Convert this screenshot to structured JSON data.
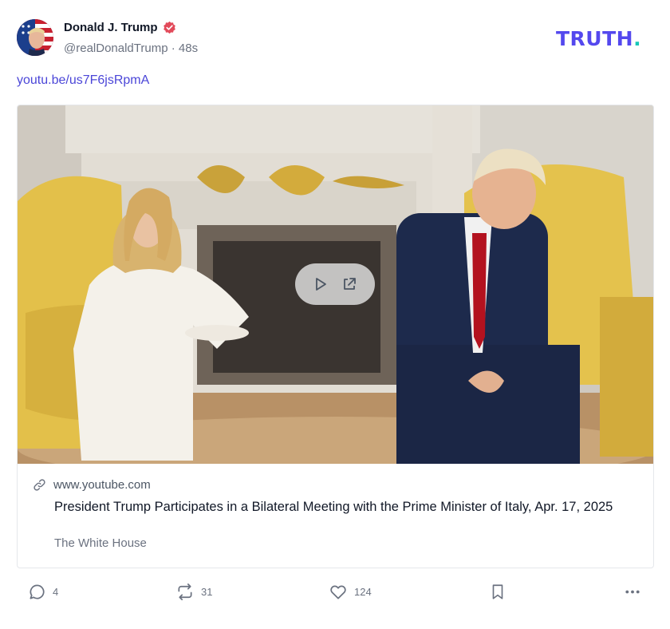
{
  "author": {
    "display_name": "Donald J. Trump",
    "handle": "@realDonaldTrump",
    "separator": "·",
    "time_ago": "48s",
    "verified_icon": "verified-badge-icon",
    "verified_color": "#e24a5a"
  },
  "brand": {
    "logo_text": "TRUTH",
    "logo_dot": ".",
    "color": "#5448ee",
    "dot_color": "#17c7b8"
  },
  "post": {
    "link_text": "youtu.be/us7F6jsRpmA"
  },
  "link_card": {
    "domain": "www.youtube.com",
    "title": "President Trump Participates in a Bilateral Meeting with the Prime Minister of Italy, Apr. 17, 2025",
    "source": "The White House",
    "overlay_icons": [
      "play-icon",
      "external-link-icon"
    ]
  },
  "actions": {
    "replies": "4",
    "retruths": "31",
    "likes": "124"
  },
  "colors": {
    "link": "#4b46d8",
    "muted": "#6b7280"
  }
}
